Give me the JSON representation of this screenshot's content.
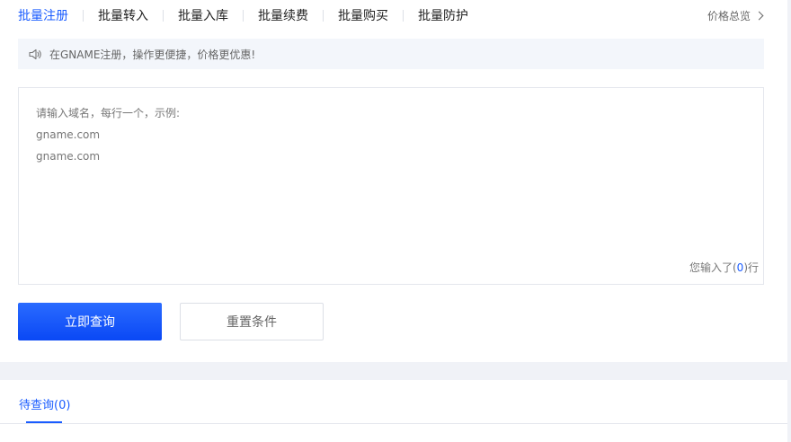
{
  "tabs": [
    {
      "label": "批量注册",
      "active": true
    },
    {
      "label": "批量转入",
      "active": false
    },
    {
      "label": "批量入库",
      "active": false
    },
    {
      "label": "批量续费",
      "active": false
    },
    {
      "label": "批量购买",
      "active": false
    },
    {
      "label": "批量防护",
      "active": false
    }
  ],
  "price_link": {
    "label": "价格总览",
    "icon": "chevron-right-icon"
  },
  "notice": {
    "icon": "speaker-icon",
    "text": "在GNAME注册，操作更便捷，价格更优惠!"
  },
  "textarea": {
    "placeholder_lines": [
      "请输入域名，每行一个，示例:",
      "gname.com",
      "gname.com"
    ],
    "counter_prefix": "您输入了(",
    "counter_value": "0",
    "counter_suffix": ")行"
  },
  "buttons": {
    "query": "立即查询",
    "reset": "重置条件"
  },
  "pending": {
    "label": "待查询(0)"
  },
  "colors": {
    "accent": "#1a5cff",
    "notice_bg": "#f3f6fb",
    "band": "#f0f2f7"
  }
}
